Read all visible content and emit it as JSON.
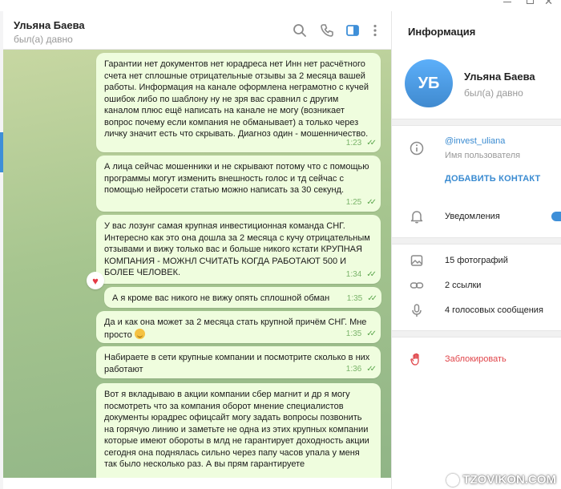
{
  "chat": {
    "name": "Ульяна Баева",
    "status": "был(а) давно"
  },
  "messages": [
    {
      "text": "Гарантии нет документов нет юрадреса нет Инн нет расчётного счета нет сплошные отрицательные отзывы за 2 месяца вашей работы. Информация на канале оформлена неграмотно с кучей ошибок либо по шаблону ну не зря вас сравнил с другим каналом плюс ещё написать на канале не могу (возникает вопрос почему если компания не обманывает) а только через личку значит есть что скрывать. Диагноз один - мошенничество.",
      "time": "1:23"
    },
    {
      "text": "А лица сейчас мошенники и не скрывают потому что с помощью программы могут изменить внешность голос и тд сейчас с помощью нейросети статью можно написать за 30 секунд.",
      "time": "1:25"
    },
    {
      "text": "У вас лозунг самая крупная инвестиционная команда СНГ. Интересно как это она дошла за 2 месяца с кучу отрицательным отзывами и вижу только вас и больше никого кстати КРУПНАЯ КОМПАНИЯ - МОЖНЛ СЧИТАТЬ КОГДА РАБОТАЮТ 500 И БОЛЕЕ ЧЕЛОВЕК.",
      "time": "1:34"
    },
    {
      "text": "А я кроме вас никого не вижу опять сплошной обман",
      "time": "1:35"
    },
    {
      "text": "Да и как она может за 2 месяца стать крупной причём СНГ. Мне просто",
      "time": "1:35"
    },
    {
      "text": "Набираете в сети крупные компании и посмотрите сколько в них работают",
      "time": "1:36"
    },
    {
      "text": "Вот я вкладываю в акции компании сбер магнит и др я могу посмотреть что за компания оборот мнение специалистов документы юрадрес офицсайт могу задать вопросы позвонить на горячую линию и заметьте не одна из этих крупных компании которые имеют обороты в млд не гарантирует доходность акции сегодня она поднялась сильно через папу часов упала у меня так было несколько раз. А вы прям гарантируете",
      "time": ""
    }
  ],
  "info": {
    "title": "Информация",
    "avatar_initials": "УБ",
    "name": "Ульяна Баева",
    "status": "был(а) давно",
    "username": "@invest_uliana",
    "username_label": "Имя пользователя",
    "add_contact": "ДОБАВИТЬ КОНТАКТ",
    "notifications": "Уведомления",
    "photos": "15 фотографий",
    "links": "2 ссылки",
    "voice": "4 голосовых сообщения",
    "block": "Заблокировать"
  },
  "watermark": "TZOVIKON.COM",
  "colors": {
    "accent": "#3e8fd8",
    "bubble": "#effdde",
    "danger": "#e0454a",
    "avatar": "#4a97e0"
  }
}
